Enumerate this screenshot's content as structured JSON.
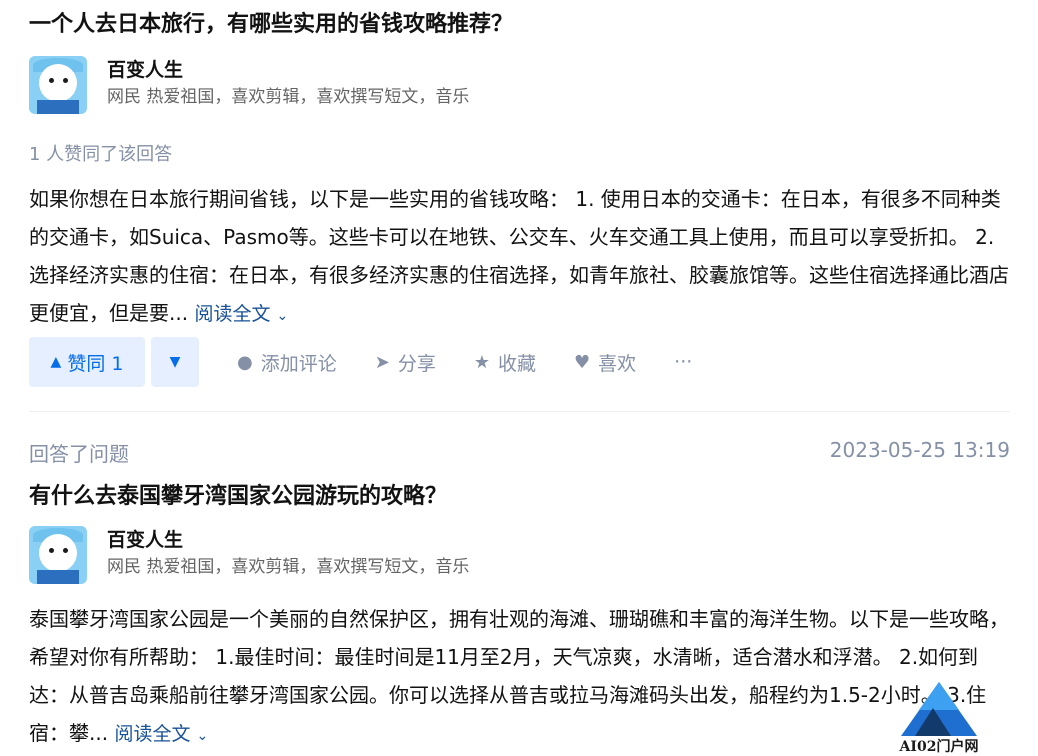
{
  "answer1": {
    "question_title": "一个人去日本旅行，有哪些实用的省钱攻略推荐？",
    "author": {
      "name": "百变人生",
      "bio": "网民 热爱祖国，喜欢剪辑，喜欢撰写短文，音乐"
    },
    "voters_text": "1 人赞同了该回答",
    "content": "如果你想在日本旅行期间省钱，以下是一些实用的省钱攻略： 1. 使用日本的交通卡：在日本，有很多不同种类的交通卡，如Suica、Pasmo等。这些卡可以在地铁、公交车、火车交通工具上使用，而且可以享受折扣。 2. 选择经济实惠的住宿：在日本，有很多经济实惠的住宿选择，如青年旅社、胶囊旅馆等。这些住宿选择通比酒店更便宜，但是要...",
    "read_more": "阅读全文",
    "actions": {
      "upvote": "赞同 1",
      "comment": "添加评论",
      "share": "分享",
      "favorite": "收藏",
      "like": "喜欢",
      "more": "···"
    }
  },
  "answer2": {
    "activity": "回答了问题",
    "timestamp": "2023-05-25 13:19",
    "question_title": "有什么去泰国攀牙湾国家公园游玩的攻略？",
    "author": {
      "name": "百变人生",
      "bio": "网民 热爱祖国，喜欢剪辑，喜欢撰写短文，音乐"
    },
    "content": "泰国攀牙湾国家公园是一个美丽的自然保护区，拥有壮观的海滩、珊瑚礁和丰富的海洋生物。以下是一些攻略，希望对你有所帮助： 1.最佳时间：最佳时间是11月至2月，天气凉爽，水清晰，适合潜水和浮潜。 2.如何到达：从普吉岛乘船前往攀牙湾国家公园。你可以选择从普吉或拉马海滩码头出发，船程约为1.5-2小时。 3.住宿：攀...",
    "read_more": "阅读全文"
  },
  "watermark": {
    "text": "AI02门户网"
  },
  "colors": {
    "accent": "#056de8",
    "link": "#175199",
    "muted": "#8590a6",
    "vote_bg": "#e6efff"
  }
}
